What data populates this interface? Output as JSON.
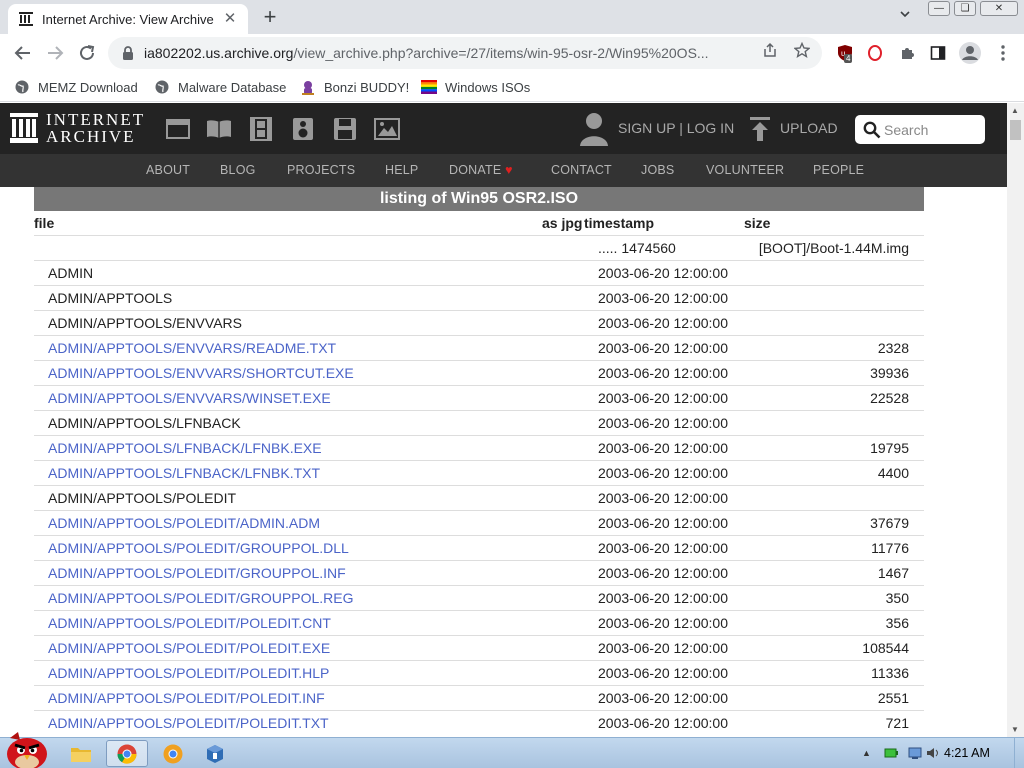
{
  "browser": {
    "tab": {
      "title": "Internet Archive: View Archive",
      "close_glyph": "✕"
    },
    "new_tab_glyph": "+",
    "url": {
      "host": "ia802202.us.archive.org",
      "path": "/view_archive.php?archive=/27/items/win-95-osr-2/Win95%20OS..."
    },
    "bookmarks": [
      "MEMZ Download",
      "Malware Database",
      "Bonzi BUDDY!",
      "Windows ISOs"
    ],
    "extension_badge": "4",
    "icons": {
      "back": "arrow-left-icon",
      "forward": "arrow-right-icon",
      "reload": "reload-icon",
      "lock": "lock-icon",
      "share": "share-icon",
      "star": "star-icon",
      "extensions": "puzzle-icon",
      "sidepanel": "side-panel-icon",
      "profile": "profile-icon",
      "menu": "kebab-menu-icon"
    }
  },
  "ia": {
    "logo_line1": "INTERNET",
    "logo_line2": "ARCHIVE",
    "signin": "SIGN UP | LOG IN",
    "upload": "UPLOAD",
    "search_placeholder": "Search",
    "nav": [
      "ABOUT",
      "BLOG",
      "PROJECTS",
      "HELP",
      "DONATE",
      "CONTACT",
      "JOBS",
      "VOLUNTEER",
      "PEOPLE"
    ],
    "donate_heart": "♥",
    "media_icons": [
      "web-icon",
      "texts-icon",
      "video-icon",
      "audio-icon",
      "software-icon",
      "images-icon"
    ]
  },
  "listing": {
    "title": "listing of Win95 OSR2.ISO",
    "headers": {
      "file": "file",
      "jpg": "as jpg",
      "timestamp": "timestamp",
      "size": "size"
    },
    "boot": {
      "ts": "..... 1474560",
      "size": "[BOOT]/Boot-1.44M.img"
    },
    "rows": [
      {
        "file": "ADMIN",
        "ts": "2003-06-20 12:00:00",
        "size": "",
        "link": false
      },
      {
        "file": "ADMIN/APPTOOLS",
        "ts": "2003-06-20 12:00:00",
        "size": "",
        "link": false
      },
      {
        "file": "ADMIN/APPTOOLS/ENVVARS",
        "ts": "2003-06-20 12:00:00",
        "size": "",
        "link": false
      },
      {
        "file": "ADMIN/APPTOOLS/ENVVARS/README.TXT",
        "ts": "2003-06-20 12:00:00",
        "size": "2328",
        "link": true
      },
      {
        "file": "ADMIN/APPTOOLS/ENVVARS/SHORTCUT.EXE",
        "ts": "2003-06-20 12:00:00",
        "size": "39936",
        "link": true
      },
      {
        "file": "ADMIN/APPTOOLS/ENVVARS/WINSET.EXE",
        "ts": "2003-06-20 12:00:00",
        "size": "22528",
        "link": true
      },
      {
        "file": "ADMIN/APPTOOLS/LFNBACK",
        "ts": "2003-06-20 12:00:00",
        "size": "",
        "link": false
      },
      {
        "file": "ADMIN/APPTOOLS/LFNBACK/LFNBK.EXE",
        "ts": "2003-06-20 12:00:00",
        "size": "19795",
        "link": true
      },
      {
        "file": "ADMIN/APPTOOLS/LFNBACK/LFNBK.TXT",
        "ts": "2003-06-20 12:00:00",
        "size": "4400",
        "link": true
      },
      {
        "file": "ADMIN/APPTOOLS/POLEDIT",
        "ts": "2003-06-20 12:00:00",
        "size": "",
        "link": false
      },
      {
        "file": "ADMIN/APPTOOLS/POLEDIT/ADMIN.ADM",
        "ts": "2003-06-20 12:00:00",
        "size": "37679",
        "link": true
      },
      {
        "file": "ADMIN/APPTOOLS/POLEDIT/GROUPPOL.DLL",
        "ts": "2003-06-20 12:00:00",
        "size": "11776",
        "link": true
      },
      {
        "file": "ADMIN/APPTOOLS/POLEDIT/GROUPPOL.INF",
        "ts": "2003-06-20 12:00:00",
        "size": "1467",
        "link": true
      },
      {
        "file": "ADMIN/APPTOOLS/POLEDIT/GROUPPOL.REG",
        "ts": "2003-06-20 12:00:00",
        "size": "350",
        "link": true
      },
      {
        "file": "ADMIN/APPTOOLS/POLEDIT/POLEDIT.CNT",
        "ts": "2003-06-20 12:00:00",
        "size": "356",
        "link": true
      },
      {
        "file": "ADMIN/APPTOOLS/POLEDIT/POLEDIT.EXE",
        "ts": "2003-06-20 12:00:00",
        "size": "108544",
        "link": true
      },
      {
        "file": "ADMIN/APPTOOLS/POLEDIT/POLEDIT.HLP",
        "ts": "2003-06-20 12:00:00",
        "size": "11336",
        "link": true
      },
      {
        "file": "ADMIN/APPTOOLS/POLEDIT/POLEDIT.INF",
        "ts": "2003-06-20 12:00:00",
        "size": "2551",
        "link": true
      },
      {
        "file": "ADMIN/APPTOOLS/POLEDIT/POLEDIT.TXT",
        "ts": "2003-06-20 12:00:00",
        "size": "721",
        "link": true
      }
    ]
  },
  "taskbar": {
    "clock": "4:21 AM",
    "apps": [
      "angry-bird-start-icon",
      "explorer-icon",
      "chrome-icon",
      "chrome-canary-icon",
      "virtualbox-icon"
    ]
  },
  "colors": {
    "link": "#4b64c8",
    "ia_header": "#232323",
    "ia_nav": "#333333",
    "listing_title_bg": "#777777",
    "heart": "#e02020"
  }
}
